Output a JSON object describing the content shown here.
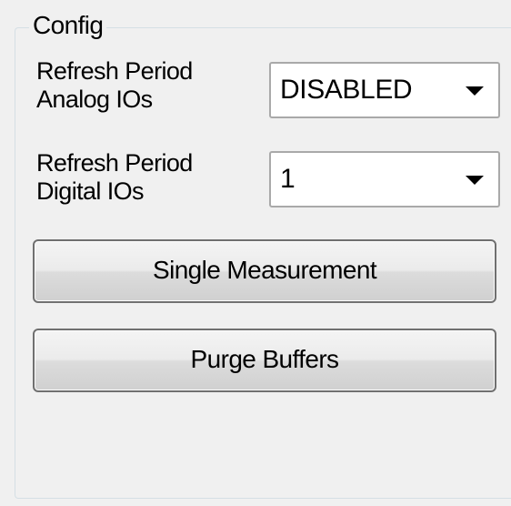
{
  "config_group": {
    "title": "Config",
    "analog_refresh": {
      "label_line1": "Refresh Period",
      "label_line2": "Analog IOs",
      "selected_value": "DISABLED"
    },
    "digital_refresh": {
      "label_line1": "Refresh Period",
      "label_line2": "Digital IOs",
      "selected_value": "1"
    },
    "buttons": {
      "single_measurement": "Single Measurement",
      "purge_buffers": "Purge Buffers"
    }
  },
  "icons": {
    "combo_arrow": "chevron-down-icon"
  }
}
